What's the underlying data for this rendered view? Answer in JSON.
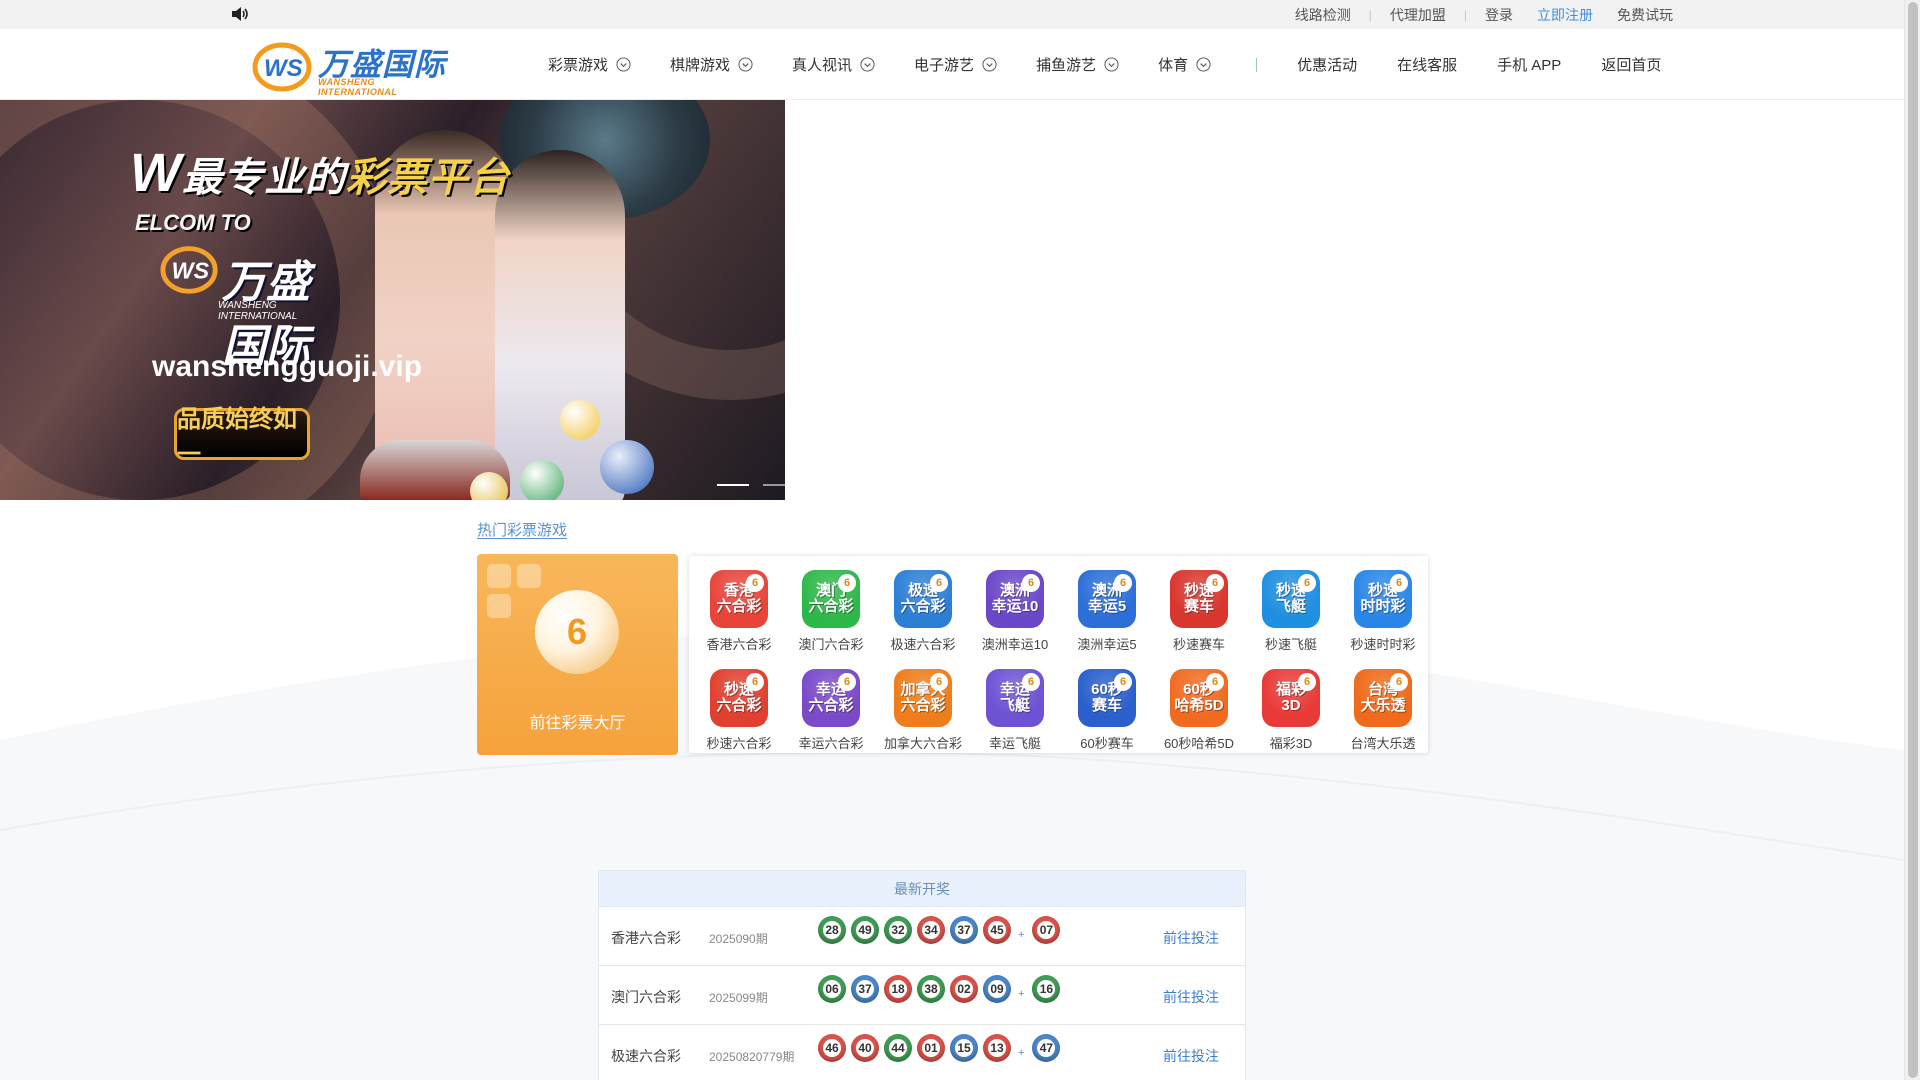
{
  "topbar": {
    "links": [
      "线路检测",
      "代理加盟"
    ],
    "login": "登录",
    "register": "立即注册",
    "trial": "免费试玩"
  },
  "logo": {
    "cn": "万盛国际",
    "en": "WANSHENG INTERNATIONAL",
    "mark": "WS"
  },
  "nav": {
    "dropdowns": [
      "彩票游戏",
      "棋牌游戏",
      "真人视讯",
      "电子游艺",
      "捕鱼游艺",
      "体育"
    ],
    "plain": [
      "优惠活动",
      "在线客服",
      "手机 APP",
      "返回首页"
    ]
  },
  "banner": {
    "headline_w": "W",
    "headline_a": "最专业的",
    "headline_b": "彩票平台",
    "sub": "ELCOM TO",
    "brand_cn": "万盛国际",
    "brand_en": "WANSHENG INTERNATIONAL",
    "brand_mark": "WS",
    "url": "wanshengguoji.vip",
    "slogan": "品质始终如一"
  },
  "hot": {
    "title": "热门彩票游戏",
    "hall_label": "前往彩票大厅",
    "hall_ball": "6",
    "games": [
      {
        "name": "香港六合彩",
        "icon_text": "香港\n六合彩",
        "color": "#e8443a"
      },
      {
        "name": "澳门六合彩",
        "icon_text": "澳门\n六合彩",
        "color": "#2fb84a"
      },
      {
        "name": "极速六合彩",
        "icon_text": "极速\n六合彩",
        "color": "#2d7fd6"
      },
      {
        "name": "澳洲幸运10",
        "icon_text": "澳洲\n幸运10",
        "color": "#6b47c9"
      },
      {
        "name": "澳洲幸运5",
        "icon_text": "澳洲\n幸运5",
        "color": "#2c6fd8"
      },
      {
        "name": "秒速赛车",
        "icon_text": "秒速\n赛车",
        "color": "#d9362e"
      },
      {
        "name": "秒速飞艇",
        "icon_text": "秒速\n飞艇",
        "color": "#1f8fe0"
      },
      {
        "name": "秒速时时彩",
        "icon_text": "秒速\n时时彩",
        "color": "#2a86e6"
      },
      {
        "name": "秒速六合彩",
        "icon_text": "秒速\n六合彩",
        "color": "#e0402f"
      },
      {
        "name": "幸运六合彩",
        "icon_text": "幸运\n六合彩",
        "color": "#7a4ac9"
      },
      {
        "name": "加拿大六合彩",
        "icon_text": "加拿大\n六合彩",
        "color": "#ef7d1b"
      },
      {
        "name": "幸运飞艇",
        "icon_text": "幸运\n飞艇",
        "color": "#6d52d4"
      },
      {
        "name": "60秒赛车",
        "icon_text": "60秒\n赛车",
        "color": "#2a5fcc"
      },
      {
        "name": "60秒哈希5D",
        "icon_text": "60秒\n哈希5D",
        "color": "#f06a1f"
      },
      {
        "name": "福彩3D",
        "icon_text": "福彩\n3D",
        "color": "#e83a36"
      },
      {
        "name": "台湾大乐透",
        "icon_text": "台湾\n大乐透",
        "color": "#ef6a1a"
      }
    ]
  },
  "draw": {
    "title": "最新开奖",
    "go_label": "前往投注",
    "plus": "+",
    "rows": [
      {
        "name": "香港六合彩",
        "issue": "2025090期",
        "numbers": [
          "28",
          "49",
          "32",
          "34",
          "37",
          "45"
        ],
        "special": "07",
        "colors": [
          "green",
          "green",
          "green",
          "red",
          "blue",
          "red"
        ],
        "special_color": "red"
      },
      {
        "name": "澳门六合彩",
        "issue": "2025099期",
        "numbers": [
          "06",
          "37",
          "18",
          "38",
          "02",
          "09"
        ],
        "special": "16",
        "colors": [
          "green",
          "blue",
          "red",
          "green",
          "red",
          "blue"
        ],
        "special_color": "green"
      },
      {
        "name": "极速六合彩",
        "issue": "20250820779期",
        "numbers": [
          "46",
          "40",
          "44",
          "01",
          "15",
          "13"
        ],
        "special": "47",
        "colors": [
          "red",
          "red",
          "green",
          "red",
          "blue",
          "red"
        ],
        "special_color": "blue"
      }
    ]
  }
}
